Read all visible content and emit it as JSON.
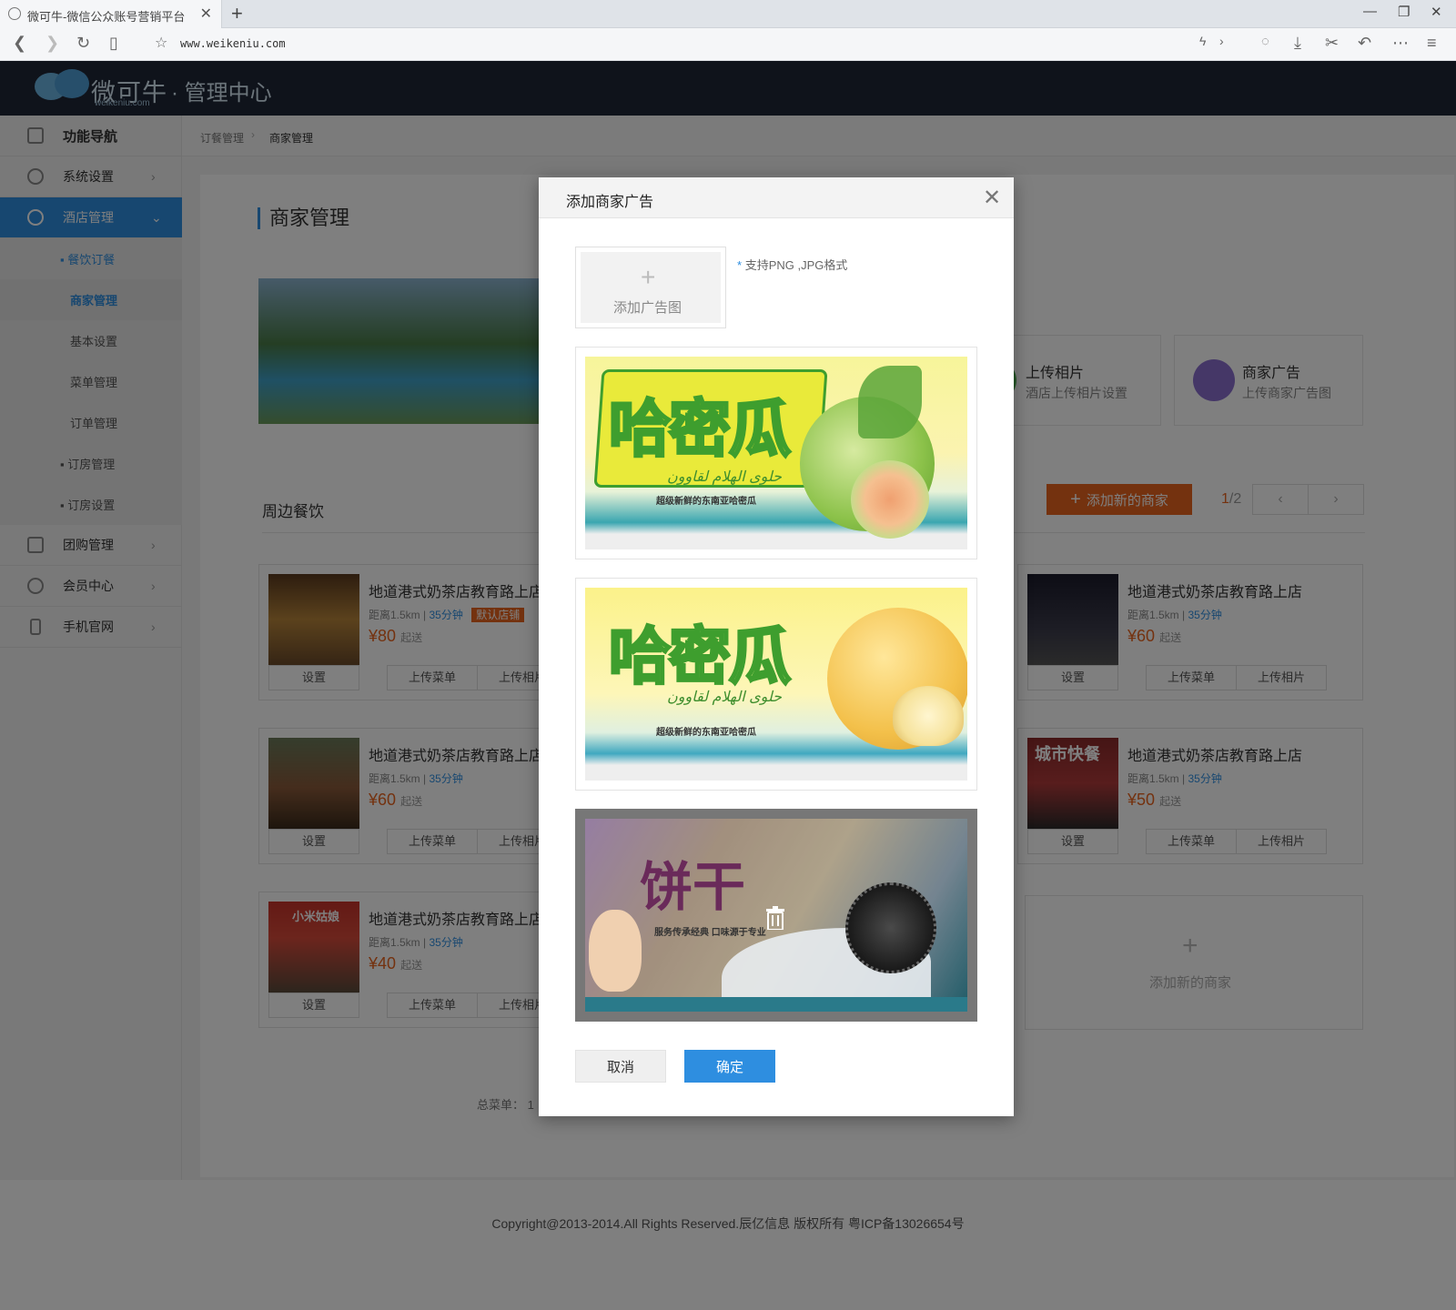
{
  "browser": {
    "tab_title": "微可牛-微信公众账号营销平台",
    "url": "www.weikeniu.com"
  },
  "header": {
    "logo_text": "微可牛",
    "logo_sub": "weikeniu.com",
    "admin_title": "· 管理中心"
  },
  "sidebar": {
    "nav_title": "功能导航",
    "items": [
      {
        "label": "系统设置"
      },
      {
        "label": "酒店管理"
      },
      {
        "label": "团购管理"
      },
      {
        "label": "会员中心"
      },
      {
        "label": "手机官网"
      }
    ],
    "sub_items": [
      {
        "label": "▪ 餐饮订餐"
      },
      {
        "label": "商家管理"
      },
      {
        "label": "基本设置"
      },
      {
        "label": "菜单管理"
      },
      {
        "label": "订单管理"
      },
      {
        "label": "▪ 订房管理"
      },
      {
        "label": "▪ 订房设置"
      }
    ]
  },
  "breadcrumb": {
    "parent": "订餐管理",
    "current": "商家管理"
  },
  "page": {
    "title": "商家管理",
    "quick_cards": [
      {
        "title": "上传相片",
        "desc": "酒店上传相片设置",
        "color": "#4cb050"
      },
      {
        "title": "商家广告",
        "desc": "上传商家广告图",
        "color": "#8a6fcf"
      }
    ],
    "section_title": "周边餐饮",
    "add_merchant_button": "添加新的商家",
    "pager": {
      "current": "1",
      "total": "/2"
    },
    "merchants_left": [
      {
        "name": "地道港式奶茶店教育路上店",
        "distance": "距离1.5km",
        "time": "35分钟",
        "badge": "默认店铺",
        "price": "¥80",
        "suffix": "起送",
        "set": "设置",
        "btn1": "上传菜单",
        "btn2": "上传相片"
      },
      {
        "name": "地道港式奶茶店教育路上店",
        "distance": "距离1.5km",
        "time": "35分钟",
        "price": "¥60",
        "suffix": "起送",
        "set": "设置",
        "btn1": "上传菜单",
        "btn2": "上传相片"
      },
      {
        "name": "地道港式奶茶店教育路上店",
        "distance": "距离1.5km",
        "time": "35分钟",
        "price": "¥40",
        "suffix": "起送",
        "set": "设置",
        "btn1": "上传菜单",
        "btn2": "上传相片"
      }
    ],
    "merchants_right": [
      {
        "name": "地道港式奶茶店教育路上店",
        "distance": "距离1.5km",
        "time": "35分钟",
        "price": "¥60",
        "suffix": "起送",
        "set": "设置",
        "btn1": "上传菜单",
        "btn2": "上传相片"
      },
      {
        "name": "地道港式奶茶店教育路上店",
        "distance": "距离1.5km",
        "time": "35分钟",
        "price": "¥50",
        "suffix": "起送",
        "set": "设置",
        "btn1": "上传菜单",
        "btn2": "上传相片",
        "sign": "城市快餐"
      }
    ],
    "add_card_label": "添加新的商家",
    "total_label": "总菜单： 1",
    "left_sign": "小米姑娘"
  },
  "footer": {
    "copyright": "Copyright@2013-2014.All Rights Reserved.辰亿信息 版权所有 粤ICP备13026654号"
  },
  "modal": {
    "title": "添加商家广告",
    "upload_label": "添加广告图",
    "upload_hint_star": "*",
    "upload_hint": "支持PNG ,JPG格式",
    "ads": [
      {
        "headline": "哈密瓜",
        "sub": "超级新鲜的东南亚哈密瓜",
        "arabic": "حلوى الهلام لقاوون"
      },
      {
        "headline": "哈密瓜",
        "sub": "超级新鲜的东南亚哈密瓜",
        "arabic": "حلوى الهلام لقاوون"
      },
      {
        "headline": "饼干",
        "sub": "服务传承经典 口味源于专业"
      }
    ],
    "cancel_label": "取消",
    "confirm_label": "确定"
  }
}
